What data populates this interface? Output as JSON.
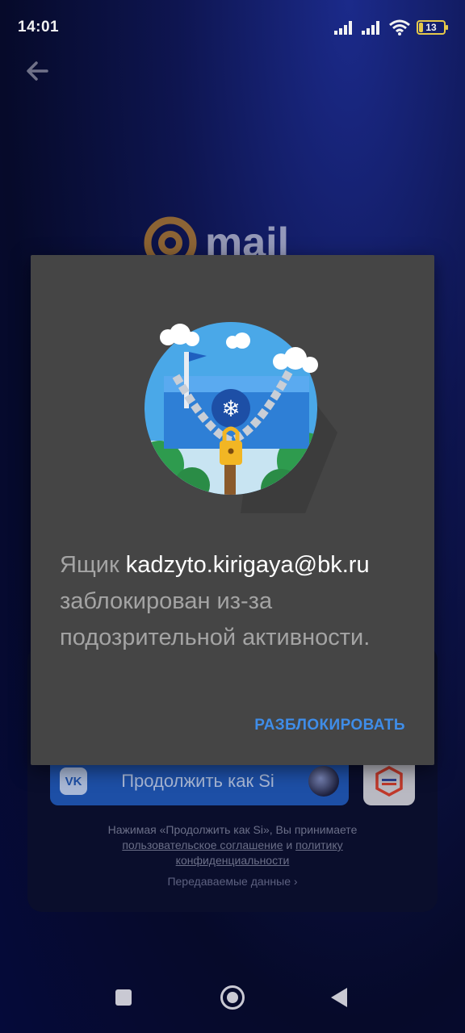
{
  "status": {
    "time": "14:01",
    "battery": "13"
  },
  "background": {
    "logo_text": "mail",
    "vk_button_label": "Продолжить как Si",
    "vk_logo_text": "VK",
    "terms_prefix": "Нажимая «Продолжить как Si», Вы принимаете",
    "terms_link1": "пользовательское соглашение",
    "terms_and": " и ",
    "terms_link2": "политику конфиденциальности",
    "transfer_label": "Передаваемые данные"
  },
  "dialog": {
    "message_prefix": "Ящик ",
    "email": "kadzyto.kirigaya@bk.ru",
    "message_suffix": " заблокирован из-за подозрительной активности.",
    "unlock_label": "РАЗБЛОКИРОВАТЬ"
  },
  "colors": {
    "accent": "#3f8de8",
    "dialog_bg": "#454545",
    "vk_blue": "#1d4fa6"
  }
}
